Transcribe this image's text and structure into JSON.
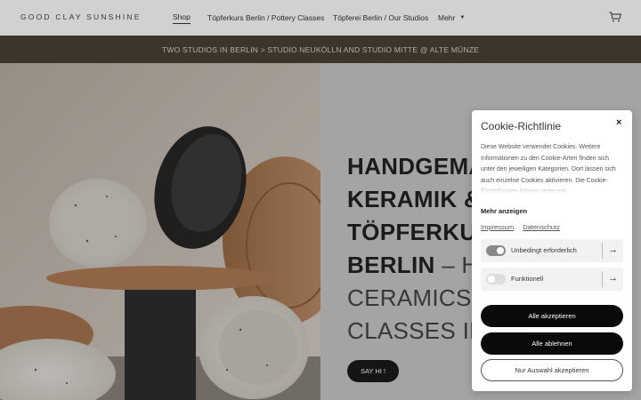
{
  "header": {
    "logo": "GOOD CLAY SUNSHINE",
    "nav": [
      {
        "label": "Shop"
      },
      {
        "label": "Töpferkurs Berlin / Pottery Classes"
      },
      {
        "label": "Töpferei Berlin / Our Studios"
      },
      {
        "label": "Mehr"
      }
    ],
    "cart_icon": "cart-icon"
  },
  "banner": {
    "text": "TWO STUDIOS IN BERLIN > STUDIO NEUKÖLLN AND STUDIO MITTE @ ALTE MÜNZE"
  },
  "hero": {
    "line1": "HANDGEMACHTE",
    "line2": "KERAMIK &",
    "line3": "TÖPFERKURSE IN",
    "line4_bold": "BERLIN",
    "line4_light": " – HANDMADE",
    "line5": "CERAMICS & POTTERY",
    "line6": "CLASSES IN BERLIN",
    "cta": "SAY HI !"
  },
  "cookie": {
    "title": "Cookie-Richtlinie",
    "close": "×",
    "text": "Diese Website verwendet Cookies. Weitere Informationen zu den Cookie-Arten finden sich unter den jeweiligen Kategorien. Dort lassen sich auch einzelne Cookies aktivieren. Die Cookie-Einstellungen können jederzeit",
    "more": "Mehr anzeigen",
    "impressum": "Impressum",
    "datenschutz": "Datenschutz",
    "toggles": [
      {
        "label": "Unbedingt erforderlich",
        "on": true
      },
      {
        "label": "Funktionell",
        "on": false
      }
    ],
    "accept_all": "Alle akzeptieren",
    "reject_all": "Alle ablehnen",
    "accept_selection": "Nur Auswahl akzeptieren"
  },
  "colors": {
    "banner_bg": "#4a4134",
    "hero_bg": "#c9c9c9",
    "button_dark": "#0a0a0a"
  }
}
